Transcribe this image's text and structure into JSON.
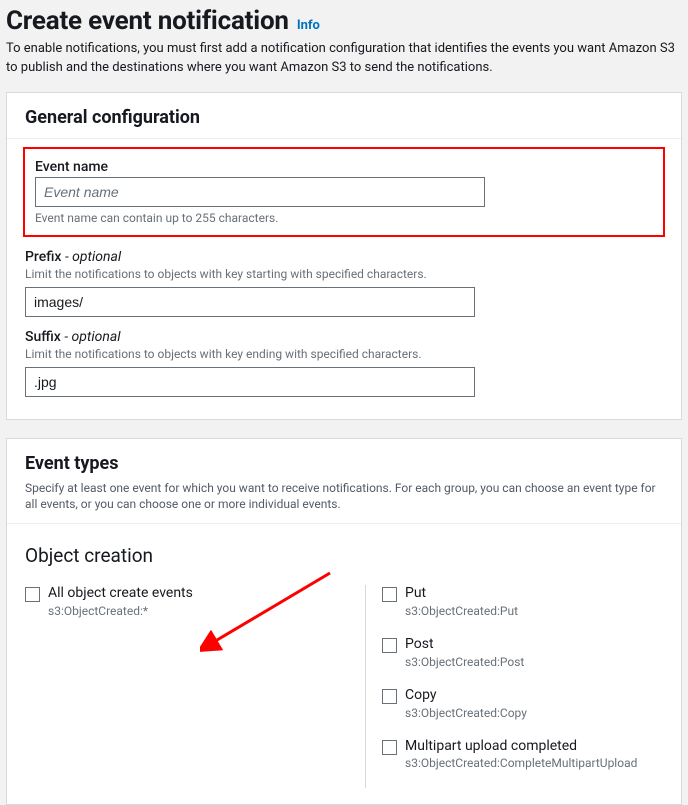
{
  "page": {
    "title": "Create event notification",
    "info_label": "Info",
    "intro": "To enable notifications, you must first add a notification configuration that identifies the events you want Amazon S3 to publish and the destinations where you want Amazon S3 to send the notifications."
  },
  "general": {
    "heading": "General configuration",
    "event_name": {
      "label": "Event name",
      "placeholder": "Event name",
      "value": "",
      "hint": "Event name can contain up to 255 characters."
    },
    "prefix": {
      "label": "Prefix",
      "optional_text": "- optional",
      "hint_top": "Limit the notifications to objects with key starting with specified characters.",
      "value": "images/"
    },
    "suffix": {
      "label": "Suffix",
      "optional_text": "- optional",
      "hint_top": "Limit the notifications to objects with key ending with specified characters.",
      "value": ".jpg"
    }
  },
  "event_types": {
    "heading": "Event types",
    "desc": "Specify at least one event for which you want to receive notifications. For each group, you can choose an event type for all events, or you can choose one or more individual events.",
    "object_creation": {
      "sub_heading": "Object creation",
      "all": {
        "label": "All object create events",
        "sub": "s3:ObjectCreated:*"
      },
      "items": [
        {
          "label": "Put",
          "sub": "s3:ObjectCreated:Put"
        },
        {
          "label": "Post",
          "sub": "s3:ObjectCreated:Post"
        },
        {
          "label": "Copy",
          "sub": "s3:ObjectCreated:Copy"
        },
        {
          "label": "Multipart upload completed",
          "sub": "s3:ObjectCreated:CompleteMultipartUpload"
        }
      ]
    }
  }
}
